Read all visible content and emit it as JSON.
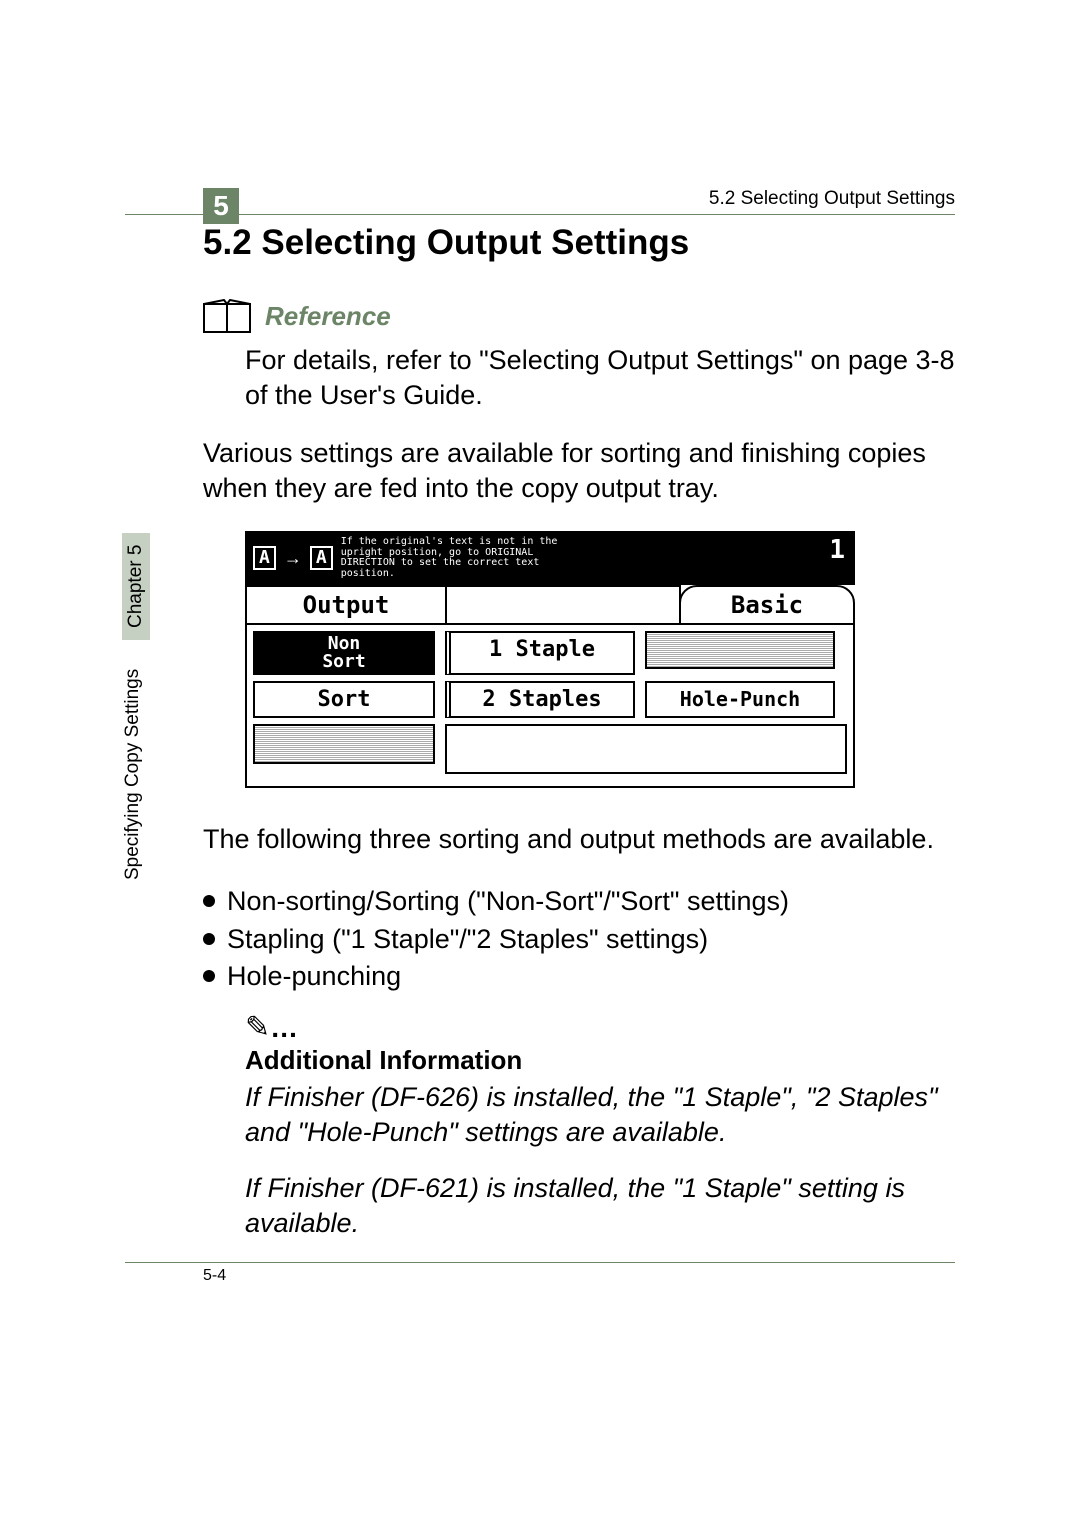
{
  "chapter_number": "5",
  "header_right": "5.2 Selecting Output Settings",
  "section_title": "5.2  Selecting Output Settings",
  "reference_label": "Reference",
  "reference_body": "For details, refer to \"Selecting Output Settings\" on page 3-8 of the User's Guide.",
  "intro_body": "Various settings are available for sorting and finishing copies when they are fed into the copy output tray.",
  "screenshot": {
    "icon_a1": "A",
    "icon_a2": "A",
    "top_msg": "If the original's text is not in the\nupright position, go to ORIGINAL\nDIRECTION to set the correct text\nposition.",
    "top_num": "1",
    "tab_output": "Output",
    "tab_basic": "Basic",
    "btn_nonsort": "Non\nSort",
    "btn_sort": "Sort",
    "btn_1staple": "1 Staple",
    "btn_2staples": "2 Staples",
    "btn_holepunch": "Hole-Punch"
  },
  "methods_intro": "The following three sorting and output methods are available.",
  "bullets": [
    "Non-sorting/Sorting (\"Non-Sort\"/\"Sort\" settings)",
    "Stapling (\"1 Staple\"/\"2 Staples\" settings)",
    "Hole-punching"
  ],
  "note_dots": "…",
  "addl_heading": "Additional Information",
  "addl_body1": "If Finisher (DF-626) is installed, the \"1 Staple\", \"2 Staples\" and \"Hole-Punch\" settings are available.",
  "addl_body2": "If Finisher (DF-621) is installed, the \"1 Staple\" setting is available.",
  "page_num": "5-4",
  "side_label": "Specifying Copy Settings",
  "side_chapter": "Chapter 5"
}
